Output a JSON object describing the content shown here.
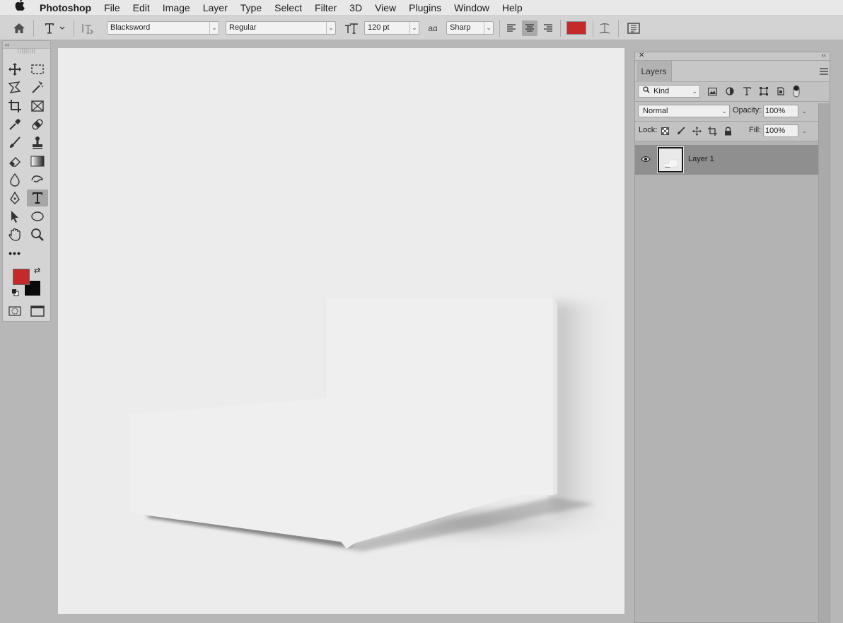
{
  "menubar": {
    "apple_icon": "apple-icon",
    "app_name": "Photoshop",
    "items": [
      "File",
      "Edit",
      "Image",
      "Layer",
      "Type",
      "Select",
      "Filter",
      "3D",
      "View",
      "Plugins",
      "Window",
      "Help"
    ]
  },
  "options_bar": {
    "font_family": "Blacksword",
    "font_style": "Regular",
    "font_size": "120 pt",
    "aa_label": "aɑ",
    "anti_alias": "Sharp",
    "text_color": "#c42a2a"
  },
  "toolbar": {
    "collapse": "‹‹",
    "more_tools": "•••",
    "foreground_color": "#c42a2a",
    "background_color": "#0a0a0a"
  },
  "layers_panel": {
    "close": "✕",
    "collapse": "‹‹",
    "tab": "Layers",
    "filter_kind": "Kind",
    "blend_mode": "Normal",
    "opacity_label": "Opacity:",
    "opacity_value": "100%",
    "lock_label": "Lock:",
    "fill_label": "Fill:",
    "fill_value": "100%",
    "layers": [
      {
        "name": "Layer 1",
        "visible": true
      }
    ]
  }
}
